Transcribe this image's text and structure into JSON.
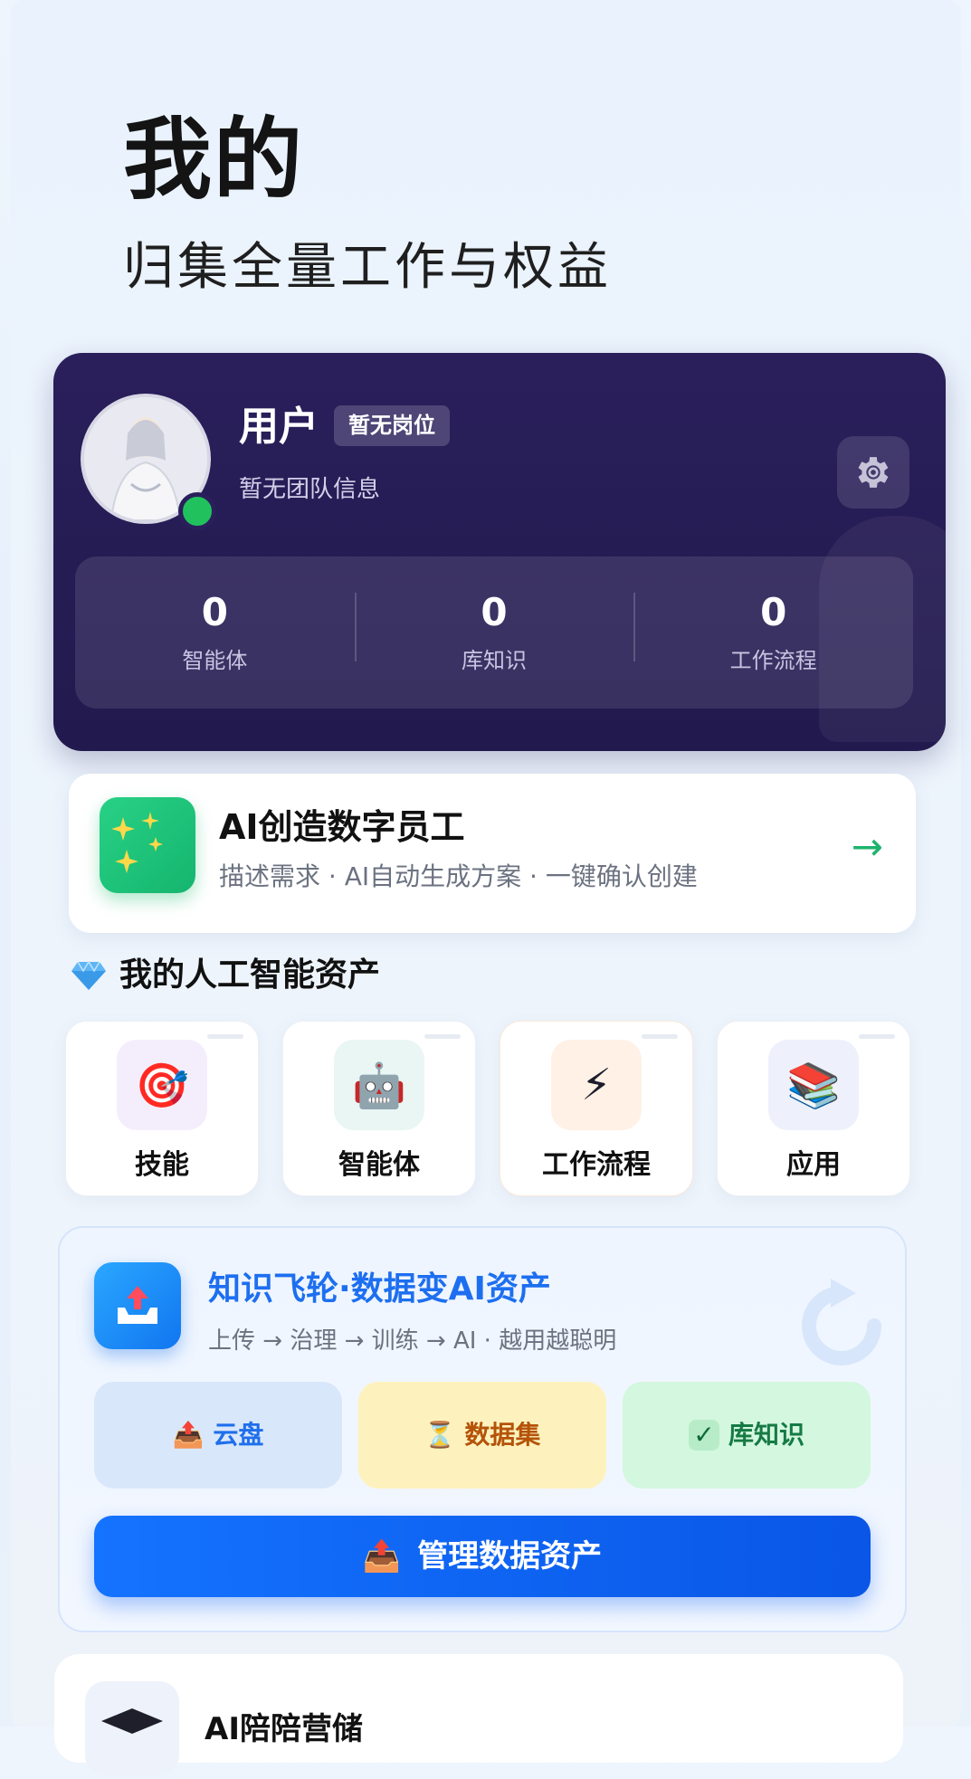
{
  "header": {
    "title": "我的",
    "subtitle": "归集全量工作与权益"
  },
  "profile": {
    "name": "用户",
    "role_badge": "暂无岗位",
    "team": "暂无团队信息",
    "stats": [
      {
        "value": "0",
        "label": "智能体"
      },
      {
        "value": "0",
        "label": "库知识"
      },
      {
        "value": "0",
        "label": "工作流程"
      }
    ]
  },
  "ai_create": {
    "title": "AI创造数字员工",
    "description": "描述需求 · AI自动生成方案 · 一键确认创建",
    "arrow": "→"
  },
  "assets": {
    "title": "我的人工智能资产",
    "items": [
      {
        "label": "技能",
        "icon": "🎯",
        "icon_name": "target-icon"
      },
      {
        "label": "智能体",
        "icon": "🤖",
        "icon_name": "robot-icon"
      },
      {
        "label": "工作流程",
        "icon": "⚡",
        "icon_name": "lightning-icon"
      },
      {
        "label": "应用",
        "icon": "📚",
        "icon_name": "books-icon"
      }
    ]
  },
  "flywheel": {
    "title": "知识飞轮·数据变AI资产",
    "description": "上传 → 治理 → 训练 → AI · 越用越聪明",
    "chips": [
      {
        "label": "云盘",
        "icon": "📤"
      },
      {
        "label": "数据集",
        "icon": "⏳"
      },
      {
        "label": "库知识",
        "icon": "✓"
      }
    ],
    "button_label": "管理数据资产",
    "button_icon": "📤"
  },
  "bottom_card": {
    "label": "AI陪陪营储"
  },
  "colors": {
    "profile_bg": "#251c54",
    "accent_green": "#1db36d",
    "accent_blue": "#1473ff",
    "online": "#21c25e"
  }
}
